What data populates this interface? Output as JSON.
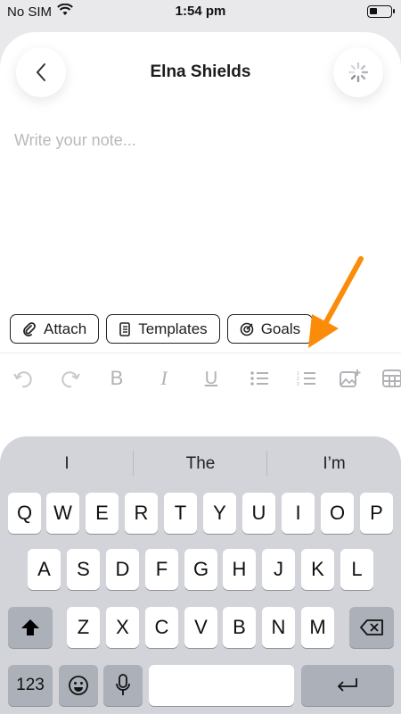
{
  "status_bar": {
    "carrier": "No SIM",
    "time": "1:54 pm"
  },
  "header": {
    "title": "Elna Shields"
  },
  "note": {
    "placeholder": "Write your note..."
  },
  "chips": [
    {
      "label": "Attach",
      "icon": "paperclip-icon"
    },
    {
      "label": "Templates",
      "icon": "notebook-icon"
    },
    {
      "label": "Goals",
      "icon": "target-icon"
    }
  ],
  "toolbar_icons": [
    "undo-icon",
    "redo-icon",
    "bold-icon",
    "italic-icon",
    "underline-icon",
    "bullet-list-icon",
    "numbered-list-icon",
    "add-image-icon",
    "table-icon"
  ],
  "keyboard": {
    "suggestions": [
      "I",
      "The",
      "I’m"
    ],
    "row1": [
      "Q",
      "W",
      "E",
      "R",
      "T",
      "Y",
      "U",
      "I",
      "O",
      "P"
    ],
    "row2": [
      "A",
      "S",
      "D",
      "F",
      "G",
      "H",
      "J",
      "K",
      "L"
    ],
    "row3": [
      "Z",
      "X",
      "C",
      "V",
      "B",
      "N",
      "M"
    ],
    "numbers_label": "123"
  },
  "colors": {
    "accent_arrow": "#fb8c0a",
    "sheet": "#ffffff",
    "keyboard_bg": "#d2d4d9"
  }
}
